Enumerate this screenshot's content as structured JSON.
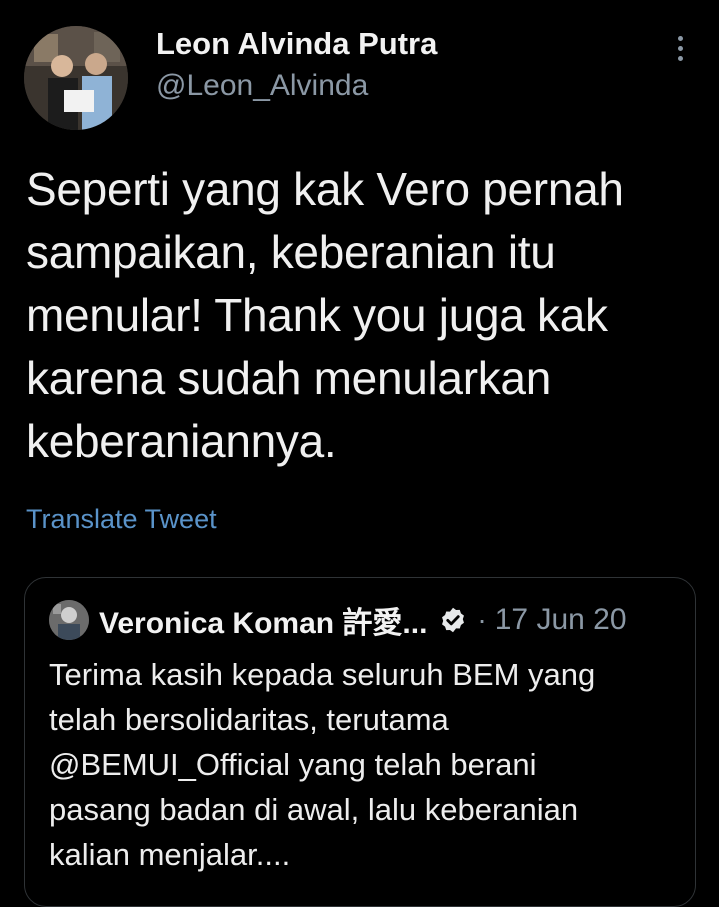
{
  "tweet": {
    "author": {
      "display_name": "Leon Alvinda Putra",
      "handle": "@Leon_Alvinda"
    },
    "menu_icon": "more-vertical-icon",
    "body_lines": [
      "Seperti yang kak Vero pernah",
      "sampaikan, keberanian itu",
      "menular! Thank you juga kak",
      "karena sudah menularkan",
      "keberaniannya."
    ],
    "translate_label": "Translate Tweet"
  },
  "quoted_tweet": {
    "display_name": "Veronica Koman 許愛...",
    "verified_icon": "verified-badge-icon",
    "separator": "·",
    "date": "17 Jun 20",
    "body_lines": [
      "Terima kasih kepada seluruh BEM yang",
      "telah bersolidaritas, terutama",
      "@BEMUI_Official yang telah berani",
      "pasang badan di awal, lalu keberanian",
      "kalian menjalar...."
    ]
  },
  "colors": {
    "background": "#000000",
    "primary_text": "#e7e9ea",
    "secondary_text": "#8b98a5",
    "link": "#5a93c9",
    "border": "#2f3336"
  }
}
